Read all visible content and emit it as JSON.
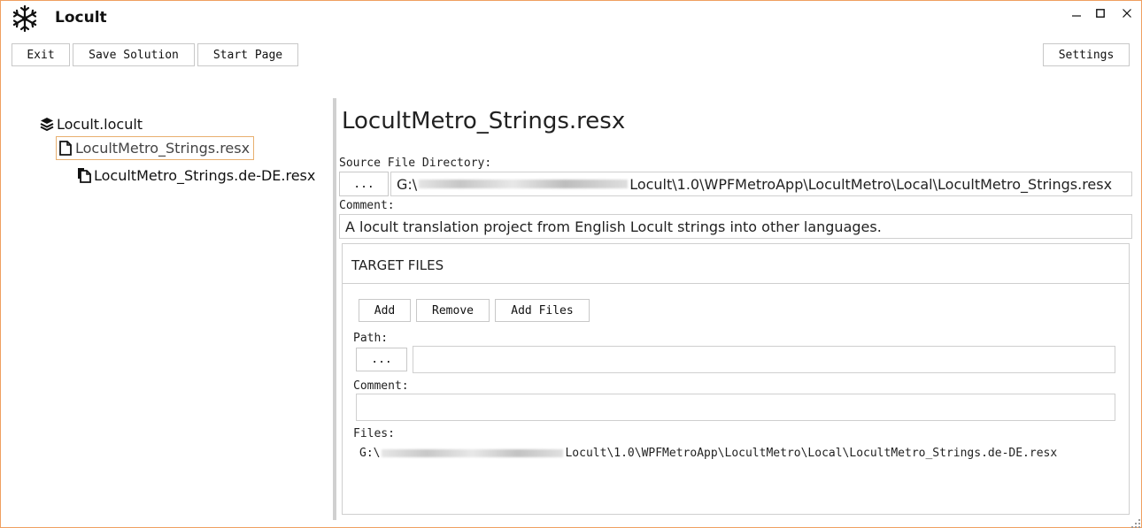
{
  "window": {
    "title": "Locult",
    "icon": "snowflake-icon",
    "controls": [
      "minimize-icon",
      "maximize-icon",
      "close-icon"
    ],
    "border_color": "#f0a060"
  },
  "toolbar": {
    "exit_label": "Exit",
    "save_label": "Save Solution",
    "start_label": "Start Page",
    "settings_label": "Settings"
  },
  "tree": {
    "root": {
      "label": "Locult.locult",
      "icon": "layers-icon"
    },
    "selected": {
      "label": "LocultMetro_Strings.resx",
      "icon": "file-icon"
    },
    "child": {
      "label": "LocultMetro_Strings.de-DE.resx",
      "icon": "files-icon"
    }
  },
  "detail": {
    "title": "LocultMetro_Strings.resx",
    "source_label": "Source File Directory:",
    "browse_label": "...",
    "source_prefix": "G:\\",
    "source_suffix": "Locult\\1.0\\WPFMetroApp\\LocultMetro\\Local\\LocultMetro_Strings.resx",
    "comment_label": "Comment:",
    "comment_value": "A locult translation project from English Locult strings into other languages."
  },
  "target": {
    "title": "TARGET FILES",
    "add_label": "Add",
    "remove_label": "Remove",
    "add_files_label": "Add Files",
    "path_label": "Path:",
    "browse_label": "...",
    "path_value": "",
    "comment_label": "Comment:",
    "comment_value": "",
    "files_label": "Files:",
    "file_prefix": "G:\\",
    "file_suffix": "Locult\\1.0\\WPFMetroApp\\LocultMetro\\Local\\LocultMetro_Strings.de-DE.resx"
  }
}
